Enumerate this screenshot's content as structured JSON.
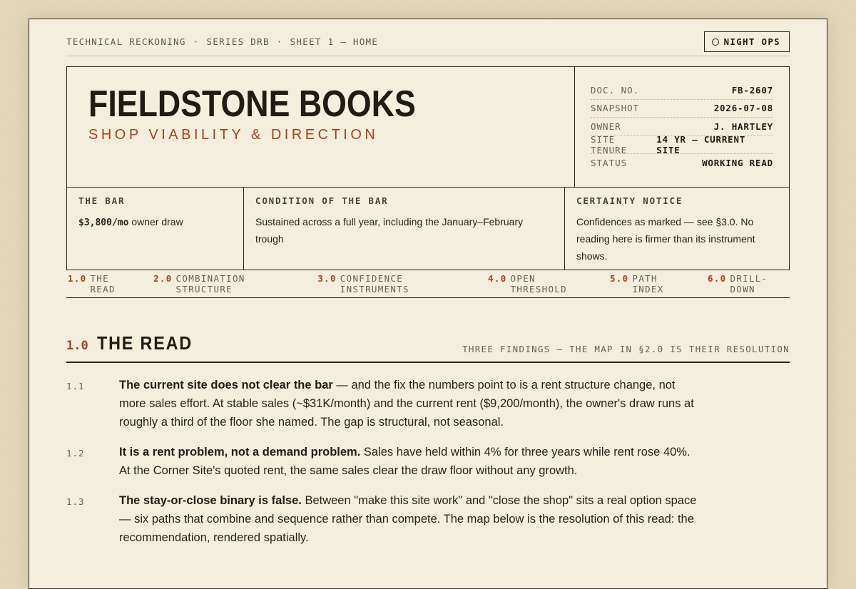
{
  "crumbs": {
    "a": "TECHNICAL RECKONING",
    "b": "SERIES DRB",
    "c": "SHEET 1 — HOME",
    "sep": "·"
  },
  "night_button": "NIGHT OPS",
  "title": "FIELDSTONE BOOKS",
  "subtitle": "SHOP VIABILITY & DIRECTION",
  "meta": [
    {
      "k": "DOC. NO.",
      "v": "FB-2607"
    },
    {
      "k": "SNAPSHOT",
      "v": "2026-07-08"
    },
    {
      "k": "OWNER",
      "v": "J. HARTLEY"
    },
    {
      "k": "SITE TENURE",
      "v": "14 YR — CURRENT SITE"
    },
    {
      "k": "STATUS",
      "v": "WORKING READ"
    }
  ],
  "cards": [
    {
      "h": "THE BAR",
      "strong": "$3,800/mo",
      "rest": " owner draw"
    },
    {
      "h": "CONDITION OF THE BAR",
      "text": "Sustained across a full year, including the January–February trough"
    },
    {
      "h": "CERTAINTY NOTICE",
      "text": "Confidences as marked — see §3.0. No reading here is firmer than its instrument shows."
    }
  ],
  "toc": [
    {
      "n": "1.0",
      "label": "THE READ"
    },
    {
      "n": "2.0",
      "label": "COMBINATION STRUCTURE"
    },
    {
      "n": "3.0",
      "label": "CONFIDENCE INSTRUMENTS"
    },
    {
      "n": "4.0",
      "label": "OPEN THRESHOLD"
    },
    {
      "n": "5.0",
      "label": "PATH INDEX"
    },
    {
      "n": "6.0",
      "label": "DRILL-DOWN"
    }
  ],
  "section": {
    "num": "1.0",
    "title": "THE READ",
    "note": "THREE FINDINGS — THE MAP IN §2.0 IS THEIR RESOLUTION"
  },
  "findings": [
    {
      "n": "1.1",
      "strong": "The current site does not clear the bar",
      "rest": " — and the fix the numbers point to is a rent structure change, not more sales effort. At stable sales (~$31K/month) and the current rent ($9,200/month), the owner's draw runs at roughly a third of the floor she named. The gap is structural, not seasonal."
    },
    {
      "n": "1.2",
      "strong": "It is a rent problem, not a demand problem.",
      "rest": " Sales have held within 4% for three years while rent rose 40%. At the Corner Site's quoted rent, the same sales clear the draw floor without any growth."
    },
    {
      "n": "1.3",
      "strong": "The stay-or-close binary is false.",
      "rest": " Between \"make this site work\" and \"close the shop\" sits a real option space — six paths that combine and sequence rather than compete. The map below is the resolution of this read: the recommendation, rendered spatially."
    }
  ]
}
